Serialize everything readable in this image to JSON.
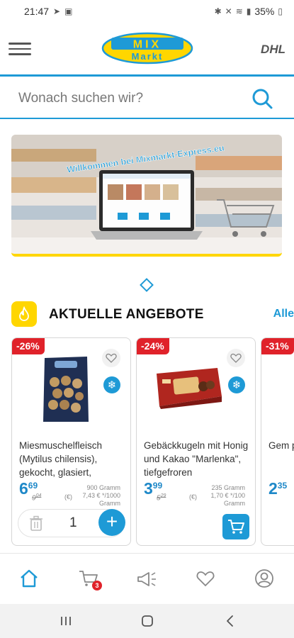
{
  "status_bar": {
    "time": "21:47",
    "battery": "35%"
  },
  "header": {
    "logo_top": "MIX",
    "logo_bottom": "Markt",
    "dhl": "DHL"
  },
  "search": {
    "placeholder": "Wonach suchen wir?"
  },
  "banner": {
    "welcome_text": "Willkommen bei Mixmarkt-Express.eu"
  },
  "section": {
    "title": "AKTUELLE ANGEBOTE",
    "all_link": "Alle"
  },
  "products": [
    {
      "discount": "-26%",
      "title": "Miesmuschelfleisch (Mytilus chilensis), gekocht, glasiert,",
      "price_int": "6",
      "price_dec": "69",
      "old_price_int": "9",
      "old_price_dec": "04",
      "euro_note": "(€)",
      "unit_line1": "900 Gramm",
      "unit_line2": "7,43 € */1000",
      "unit_line3": "Gramm",
      "quantity": "1"
    },
    {
      "discount": "-24%",
      "title": "Gebäckkugeln mit Honig und Kakao \"Marlenka\", tiefgefroren",
      "price_int": "3",
      "price_dec": "99",
      "old_price_int": "5",
      "old_price_dec": "29",
      "euro_note": "(€)",
      "unit_line1": "235 Gramm",
      "unit_line2": "1,70 € */100",
      "unit_line3": "Gramm"
    },
    {
      "discount": "-31%",
      "title": "Gem past",
      "price_int": "2",
      "price_dec": "35"
    }
  ],
  "bottom_nav": {
    "cart_badge": "3"
  },
  "colors": {
    "accent": "#1e9ad6",
    "brand_yellow": "#ffd600",
    "discount_red": "#e0222a"
  }
}
